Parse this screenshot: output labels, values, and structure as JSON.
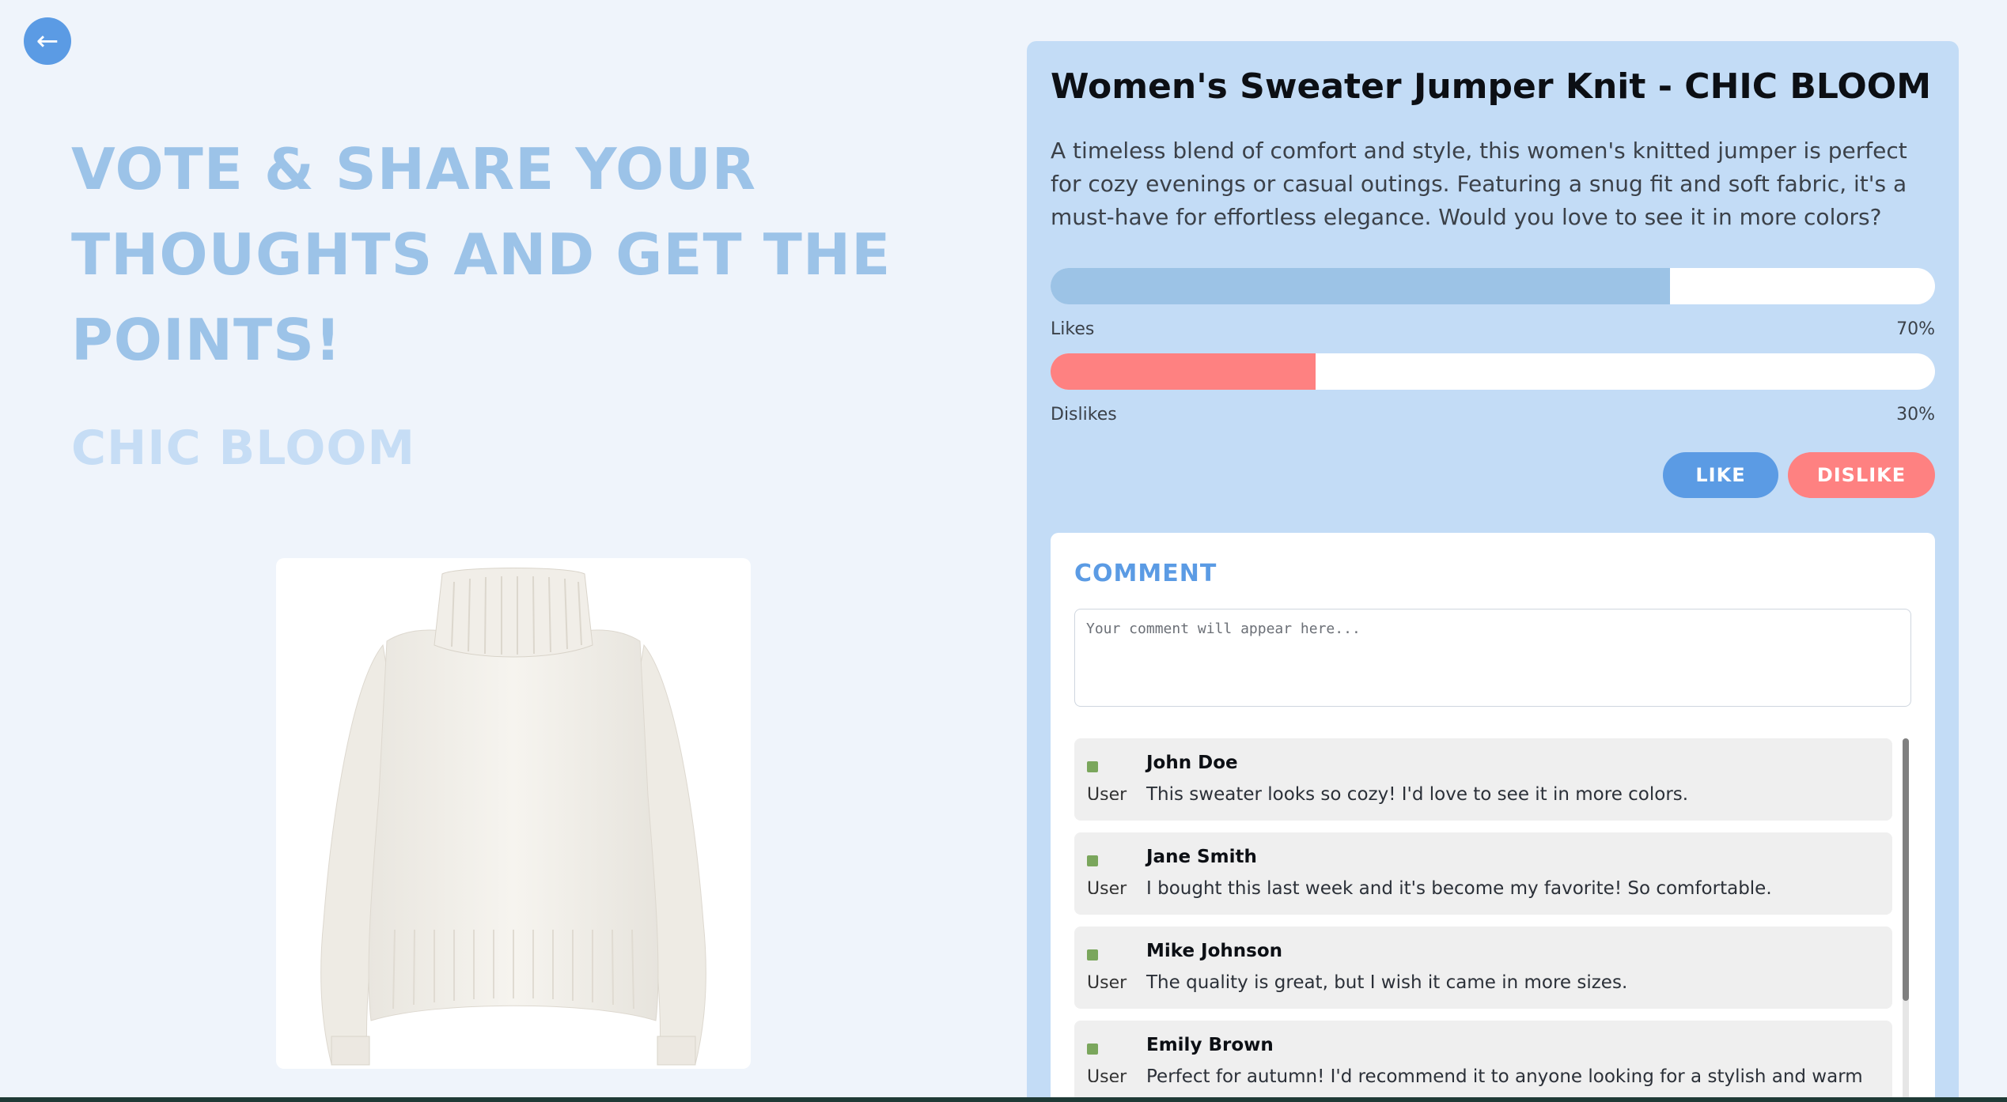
{
  "nav": {
    "back_icon": "←"
  },
  "hero": {
    "headline": "VOTE & SHARE YOUR THOUGHTS AND GET THE POINTS!",
    "brand": "CHIC BLOOM"
  },
  "product": {
    "title": "Women's Sweater Jumper Knit - CHIC BLOOM",
    "description": "A timeless blend of comfort and style, this women's knitted jumper is perfect for cozy evenings or casual outings. Featuring a snug fit and soft fabric, it's a must-have for effortless elegance. Would you love to see it in more colors?",
    "image_alt": "White knitted turtleneck sweater"
  },
  "votes": {
    "likes_label": "Likes",
    "likes_pct": "70%",
    "likes_fraction": 0.7,
    "dislikes_label": "Dislikes",
    "dislikes_pct": "30%",
    "dislikes_fraction": 0.3
  },
  "actions": {
    "like_label": "LIKE",
    "dislike_label": "DISLIKE"
  },
  "comments": {
    "heading": "COMMENT",
    "placeholder": "Your comment will appear here...",
    "avatar_alt": "User avatar",
    "items": [
      {
        "name": "John Doe",
        "text": "This sweater looks so cozy! I'd love to see it in more colors."
      },
      {
        "name": "Jane Smith",
        "text": "I bought this last week and it's become my favorite! So comfortable."
      },
      {
        "name": "Mike Johnson",
        "text": "The quality is great, but I wish it came in more sizes."
      },
      {
        "name": "Emily Brown",
        "text": "Perfect for autumn! I'd recommend it to anyone looking for a stylish and warm"
      }
    ]
  },
  "colors": {
    "accent": "#5b9be4",
    "likes_bar": "#9cc3e6",
    "dislikes_bar": "#fe8181",
    "panel_bg": "#c3dcf6",
    "page_bg": "#eff4fb"
  }
}
